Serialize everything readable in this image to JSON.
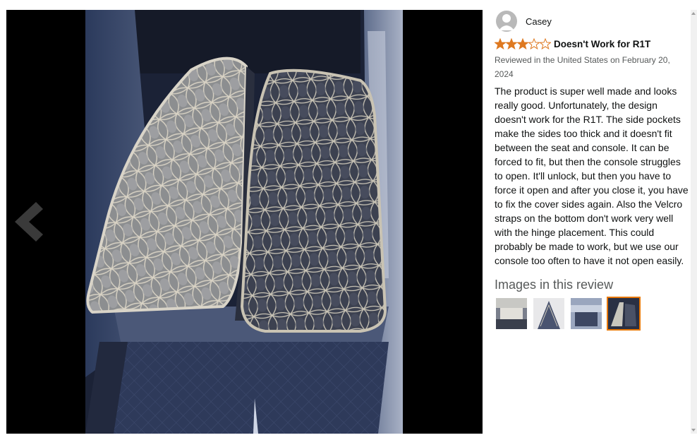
{
  "review": {
    "reviewer_name": "Casey",
    "rating": 3,
    "rating_max": 5,
    "title": "Doesn't Work for R1T",
    "meta": "Reviewed in the United States on February 20, 2024",
    "body": "The product is super well made and looks really good. Unfortunately, the design doesn't work for the R1T. The side pockets make the sides too thick and it doesn't fit between the seat and console. It can be forced to fit, but then the console struggles to open. It'll unlock, but then you have to force it open and after you close it, you have to fix the cover sides again. Also the Velcro straps on the bottom don't work very well with the hinge placement. This could probably be made to work, but we use our console too often to have it not open easily.",
    "images_heading": "Images in this review",
    "thumbnails": [
      {
        "active": false
      },
      {
        "active": false
      },
      {
        "active": false
      },
      {
        "active": true
      }
    ]
  },
  "colors": {
    "star_fill": "#de7921",
    "active_thumb_border": "#e77600"
  }
}
